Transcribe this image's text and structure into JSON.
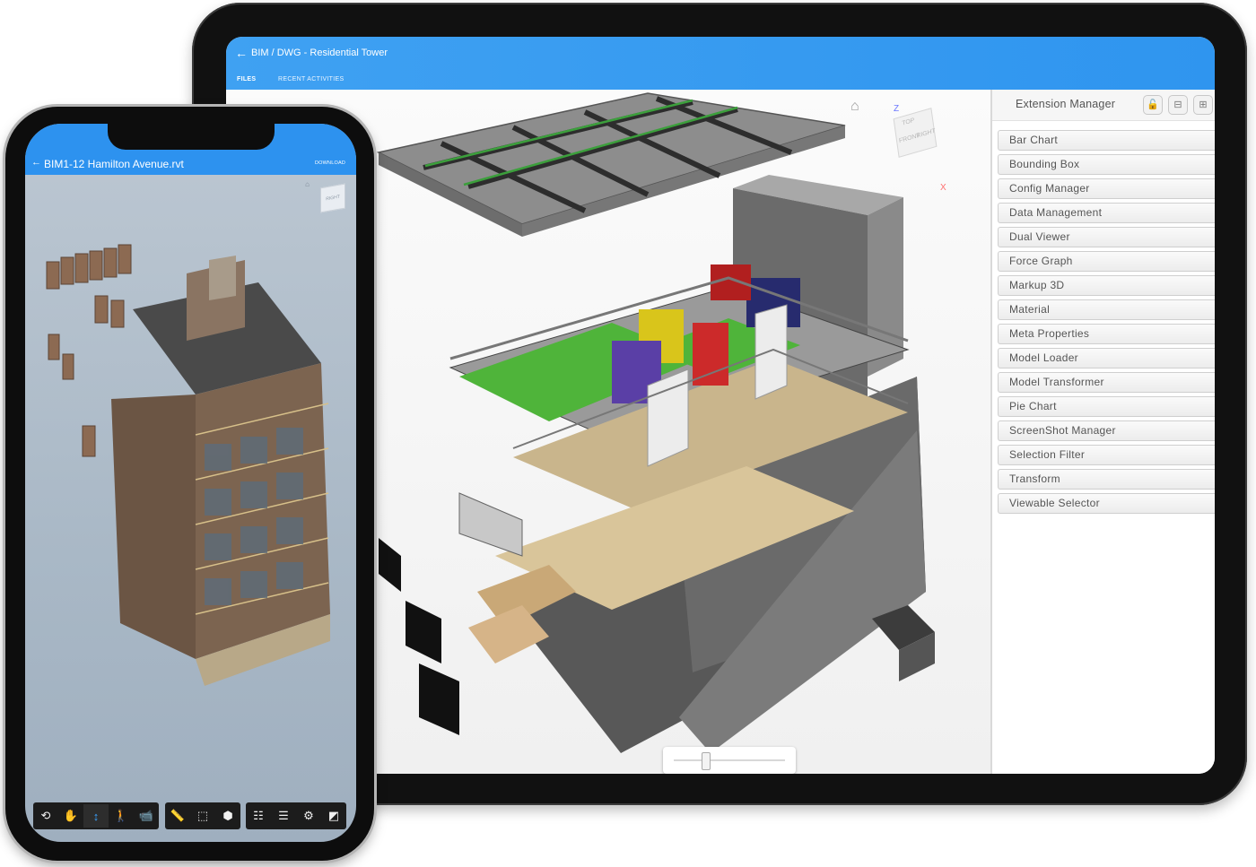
{
  "tablet": {
    "title": "BIM / DWG - Residential Tower",
    "back_icon": "arrow-left-icon",
    "tabs": [
      {
        "label": "FILES",
        "active": true
      },
      {
        "label": "RECENT ACTIVITIES",
        "active": false
      }
    ],
    "accent_color": "#2f95ef",
    "viewcube": {
      "faces": [
        "TOP",
        "FRONT",
        "RIGHT"
      ],
      "axes": [
        "Z",
        "X"
      ]
    },
    "extension_manager": {
      "title": "Extension Manager",
      "header_buttons": [
        "lock-icon",
        "collapse-icon",
        "expand-icon"
      ],
      "items": [
        "Bar Chart",
        "Bounding Box",
        "Config Manager",
        "Data Management",
        "Dual Viewer",
        "Force Graph",
        "Markup 3D",
        "Material",
        "Meta Properties",
        "Model Loader",
        "Model Transformer",
        "Pie Chart",
        "ScreenShot Manager",
        "Selection Filter",
        "Transform",
        "Viewable Selector"
      ]
    },
    "explode_slider": {
      "value": 0.28
    },
    "toolbar": {
      "groups": [
        [
          "orbit-icon",
          "pan-icon",
          "zoom-icon",
          "first-person-icon",
          "camera-icon"
        ],
        [
          "measure-icon",
          "section-icon",
          "explode-icon"
        ],
        [
          "model-browser-icon",
          "properties-icon",
          "settings-icon",
          "fullscreen-icon"
        ]
      ],
      "active": "orbit-icon",
      "highlighted": "explode-icon"
    }
  },
  "phone": {
    "title": "BIM1-12 Hamilton Avenue.rvt",
    "back_icon": "arrow-left-icon",
    "download_label": "DOWNLOAD",
    "viewcube_face": "RIGHT",
    "toolbar": {
      "groups": [
        [
          "orbit-icon",
          "pan-icon",
          "zoom-icon",
          "first-person-icon",
          "camera-icon"
        ],
        [
          "measure-icon",
          "section-icon",
          "explode-icon"
        ],
        [
          "model-browser-icon",
          "properties-icon",
          "settings-icon",
          "fullscreen-icon"
        ]
      ],
      "active": "zoom-icon"
    }
  }
}
